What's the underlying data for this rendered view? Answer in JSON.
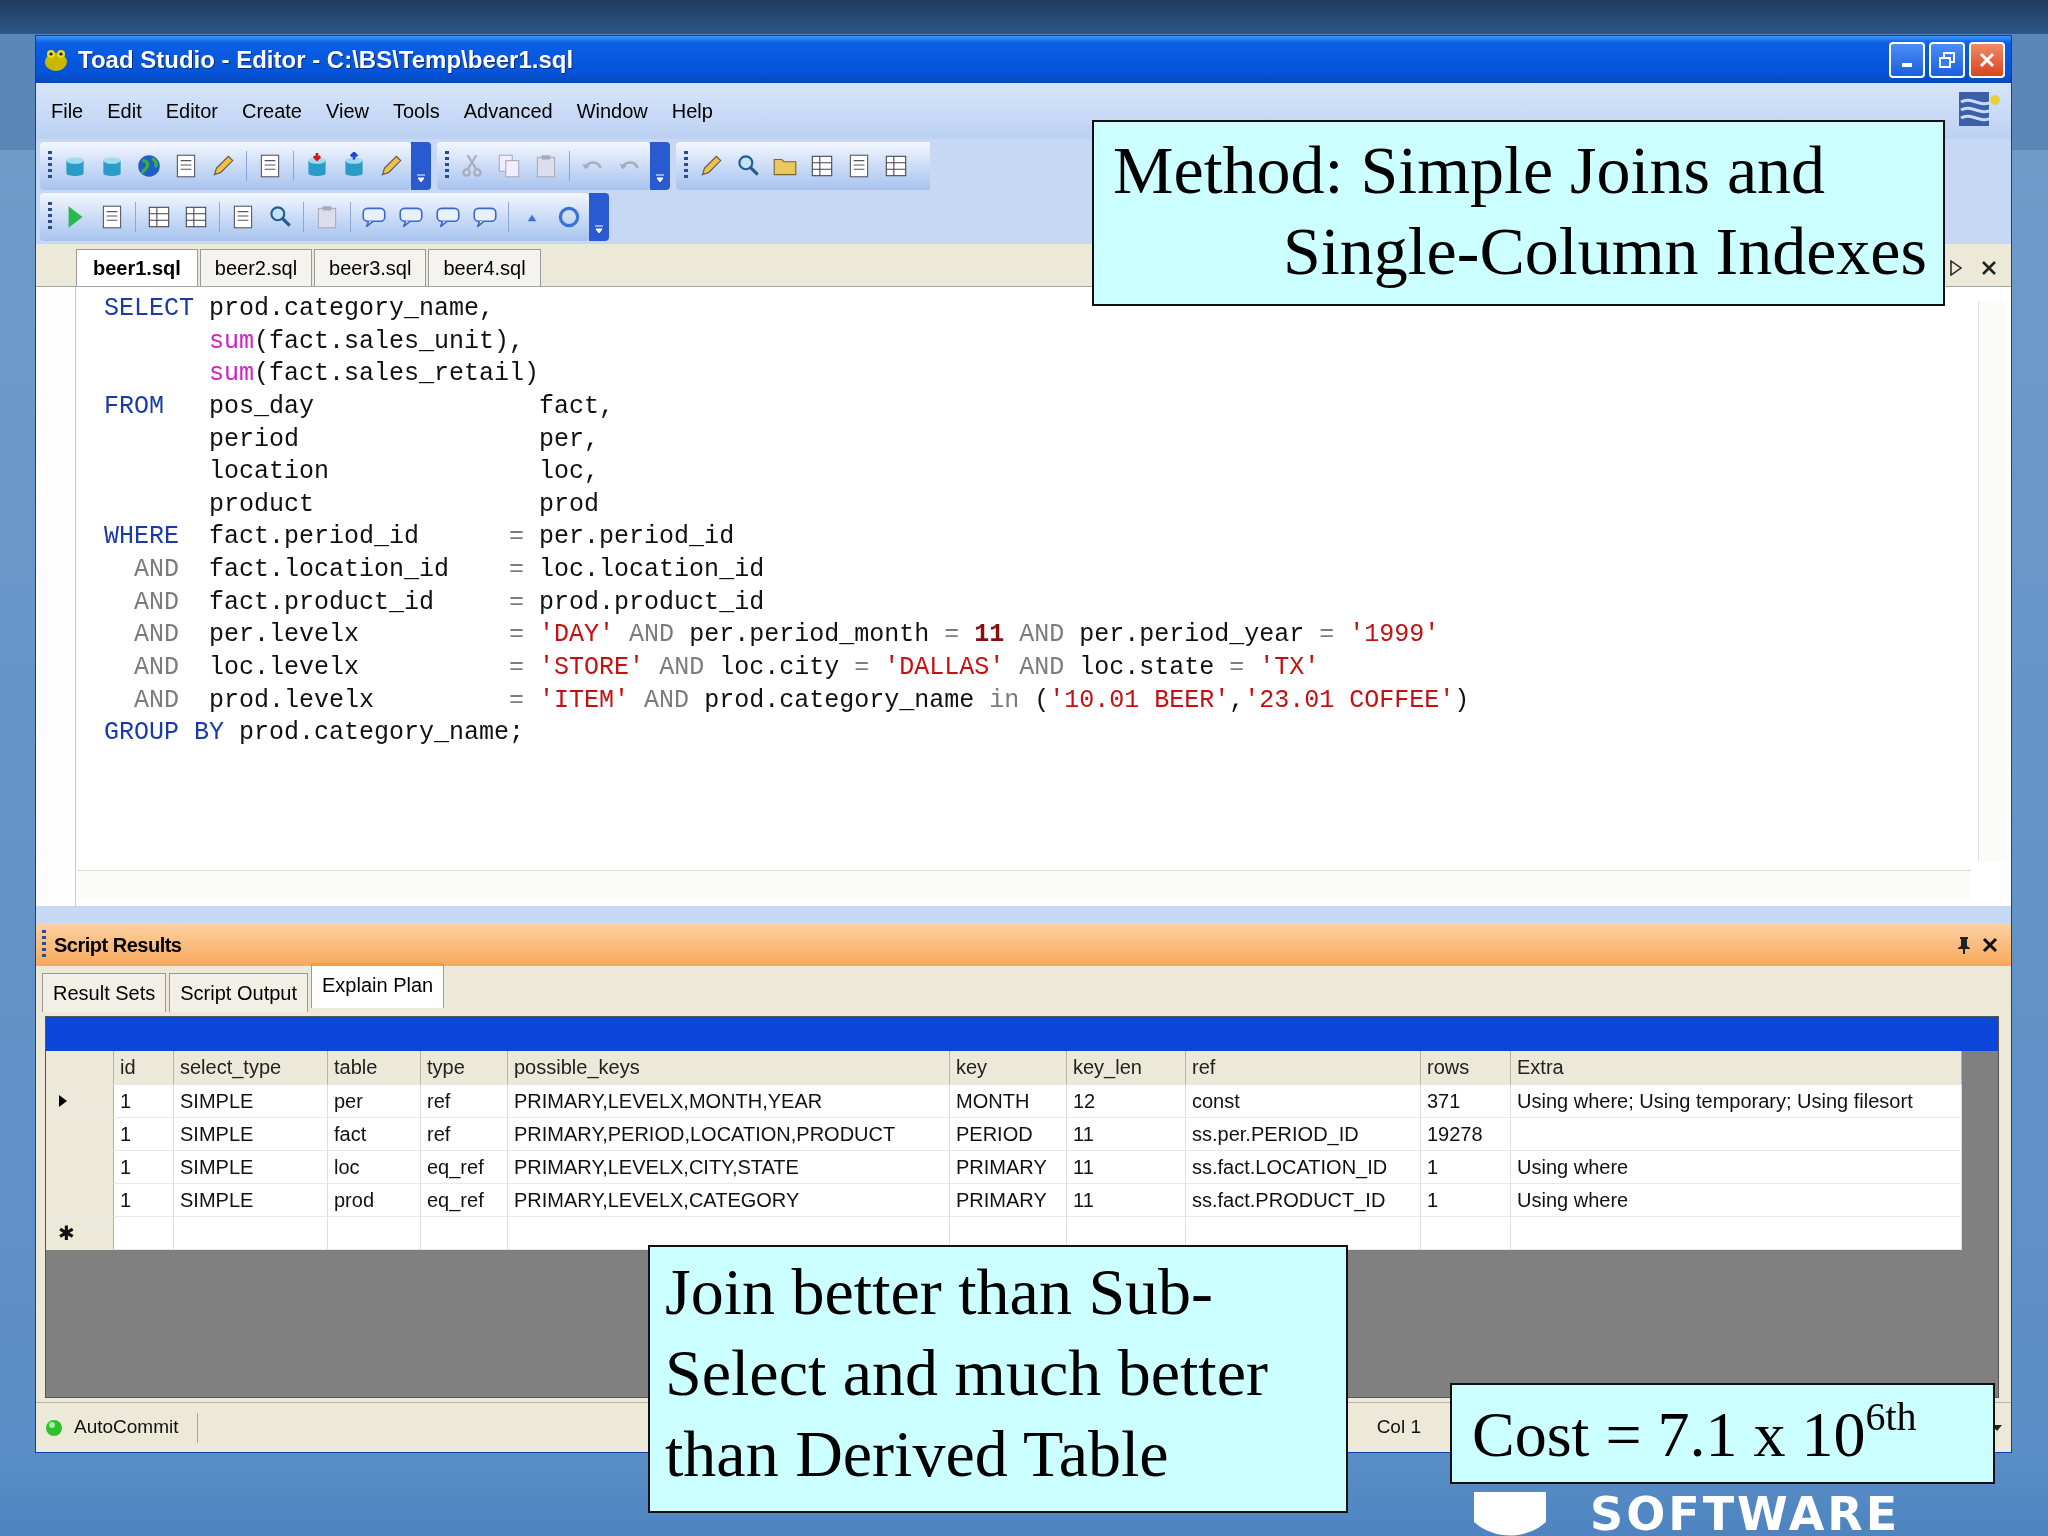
{
  "window": {
    "title": "Toad Studio - Editor - C:\\BS\\Temp\\beer1.sql"
  },
  "menu": [
    "File",
    "Edit",
    "Editor",
    "Create",
    "View",
    "Tools",
    "Advanced",
    "Window",
    "Help"
  ],
  "editor_tabs": [
    {
      "label": "beer1.sql",
      "selected": true
    },
    {
      "label": "beer2.sql",
      "selected": false
    },
    {
      "label": "beer3.sql",
      "selected": false
    },
    {
      "label": "beer4.sql",
      "selected": false
    }
  ],
  "editor": {
    "lines": [
      [
        {
          "kind": "keyword",
          "text": "SELECT"
        },
        {
          "kind": "text",
          "text": " prod.category_name,"
        }
      ],
      [
        {
          "kind": "function",
          "text": "       sum"
        },
        {
          "kind": "text",
          "text": "(fact.sales_unit),"
        }
      ],
      [
        {
          "kind": "function",
          "text": "       sum"
        },
        {
          "kind": "text",
          "text": "(fact.sales_retail)"
        }
      ],
      [
        {
          "kind": "keyword",
          "text": "FROM"
        },
        {
          "kind": "text",
          "text": "   pos_day               fact,"
        }
      ],
      [
        {
          "kind": "text",
          "text": "       period                per,"
        }
      ],
      [
        {
          "kind": "text",
          "text": "       location              loc,"
        }
      ],
      [
        {
          "kind": "text",
          "text": "       product               prod"
        }
      ],
      [
        {
          "kind": "keyword",
          "text": "WHERE"
        },
        {
          "kind": "text",
          "text": "  fact.period_id      "
        },
        {
          "kind": "operator",
          "text": "="
        },
        {
          "kind": "text",
          "text": " per.period_id"
        }
      ],
      [
        {
          "kind": "operator",
          "text": "  AND"
        },
        {
          "kind": "text",
          "text": "  fact.location_id    "
        },
        {
          "kind": "operator",
          "text": "="
        },
        {
          "kind": "text",
          "text": " loc.location_id"
        }
      ],
      [
        {
          "kind": "operator",
          "text": "  AND"
        },
        {
          "kind": "text",
          "text": "  fact.product_id     "
        },
        {
          "kind": "operator",
          "text": "="
        },
        {
          "kind": "text",
          "text": " prod.product_id"
        }
      ],
      [
        {
          "kind": "operator",
          "text": "  AND"
        },
        {
          "kind": "text",
          "text": "  per.levelx          "
        },
        {
          "kind": "operator",
          "text": "= "
        },
        {
          "kind": "string",
          "text": "'DAY'"
        },
        {
          "kind": "operator",
          "text": " AND "
        },
        {
          "kind": "text",
          "text": "per.period_month "
        },
        {
          "kind": "operator",
          "text": "= "
        },
        {
          "kind": "number",
          "text": "11"
        },
        {
          "kind": "operator",
          "text": " AND "
        },
        {
          "kind": "text",
          "text": "per.period_year "
        },
        {
          "kind": "operator",
          "text": "= "
        },
        {
          "kind": "string",
          "text": "'1999'"
        }
      ],
      [
        {
          "kind": "operator",
          "text": "  AND"
        },
        {
          "kind": "text",
          "text": "  loc.levelx          "
        },
        {
          "kind": "operator",
          "text": "= "
        },
        {
          "kind": "string",
          "text": "'STORE'"
        },
        {
          "kind": "operator",
          "text": " AND "
        },
        {
          "kind": "text",
          "text": "loc.city "
        },
        {
          "kind": "operator",
          "text": "= "
        },
        {
          "kind": "string",
          "text": "'DALLAS'"
        },
        {
          "kind": "operator",
          "text": " AND "
        },
        {
          "kind": "text",
          "text": "loc.state "
        },
        {
          "kind": "operator",
          "text": "= "
        },
        {
          "kind": "string",
          "text": "'TX'"
        }
      ],
      [
        {
          "kind": "operator",
          "text": "  AND"
        },
        {
          "kind": "text",
          "text": "  prod.levelx         "
        },
        {
          "kind": "operator",
          "text": "= "
        },
        {
          "kind": "string",
          "text": "'ITEM'"
        },
        {
          "kind": "operator",
          "text": " AND "
        },
        {
          "kind": "text",
          "text": "prod.category_name "
        },
        {
          "kind": "operator",
          "text": "in"
        },
        {
          "kind": "text",
          "text": " ("
        },
        {
          "kind": "string",
          "text": "'10.01 BEER'"
        },
        {
          "kind": "text",
          "text": ","
        },
        {
          "kind": "string",
          "text": "'23.01 COFFEE'"
        },
        {
          "kind": "text",
          "text": ")"
        }
      ],
      [
        {
          "kind": "keyword",
          "text": "GROUP BY"
        },
        {
          "kind": "text",
          "text": " prod.category_name;"
        }
      ]
    ]
  },
  "results_panel": {
    "title": "Script Results",
    "tabs": [
      {
        "label": "Result Sets",
        "selected": false
      },
      {
        "label": "Script Output",
        "selected": false
      },
      {
        "label": "Explain Plan",
        "selected": true
      }
    ],
    "grid": {
      "columns": [
        "id",
        "select_type",
        "table",
        "type",
        "possible_keys",
        "key",
        "key_len",
        "ref",
        "rows",
        "Extra"
      ],
      "rows": [
        {
          "selected": true,
          "cells": [
            "1",
            "SIMPLE",
            "per",
            "ref",
            "PRIMARY,LEVELX,MONTH,YEAR",
            "MONTH",
            "12",
            "const",
            "371",
            "Using where; Using temporary; Using filesort"
          ]
        },
        {
          "selected": false,
          "cells": [
            "1",
            "SIMPLE",
            "fact",
            "ref",
            "PRIMARY,PERIOD,LOCATION,PRODUCT",
            "PERIOD",
            "11",
            "ss.per.PERIOD_ID",
            "19278",
            null
          ]
        },
        {
          "selected": false,
          "cells": [
            "1",
            "SIMPLE",
            "loc",
            "eq_ref",
            "PRIMARY,LEVELX,CITY,STATE",
            "PRIMARY",
            "11",
            "ss.fact.LOCATION_ID",
            "1",
            "Using where"
          ]
        },
        {
          "selected": false,
          "cells": [
            "1",
            "SIMPLE",
            "prod",
            "eq_ref",
            "PRIMARY,LEVELX,CATEGORY",
            "PRIMARY",
            "11",
            "ss.fact.PRODUCT_ID",
            "1",
            "Using where"
          ]
        }
      ],
      "new_row_marker": "✱"
    }
  },
  "status_bar": {
    "autocommit": "AutoCommit",
    "position": "Col 1"
  },
  "title_callout": {
    "lines": [
      "Method: Simple Joins and",
      "Single-Column Indexes"
    ]
  },
  "note_callout": {
    "text": "Join better than Sub-Select and much better than Derived Table"
  },
  "cost_callout": {
    "text": "Cost = 7.1 x 10$^{6th}$"
  },
  "slide_footer": {
    "logo_text": "SOFTWARE"
  }
}
